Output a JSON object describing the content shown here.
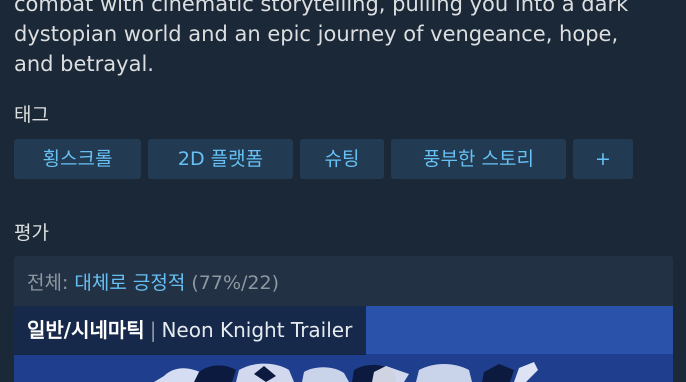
{
  "description": {
    "lines": [
      "combat with cinematic storytelling, pulling you into a dark",
      "dystopian world and an epic journey of vengeance, hope,",
      "and betrayal."
    ]
  },
  "tags_section": {
    "title": "태그",
    "tags": [
      "횡스크롤",
      "2D 플랫폼",
      "슈팅",
      "풍부한 스토리",
      "+"
    ]
  },
  "reviews_section": {
    "title": "평가",
    "overall_label": "전체: ",
    "overall_summary": "대체로 긍정적",
    "overall_stats": " (77%/22)"
  },
  "trailer": {
    "category": "일반/시네마틱",
    "separator": "|",
    "title": "Neon Knight Trailer"
  },
  "colors": {
    "background": "#1b2838",
    "tag_background": "#223b52",
    "tag_text": "#67c1f5",
    "positive": "#66c0f4",
    "muted": "#8f98a0"
  }
}
